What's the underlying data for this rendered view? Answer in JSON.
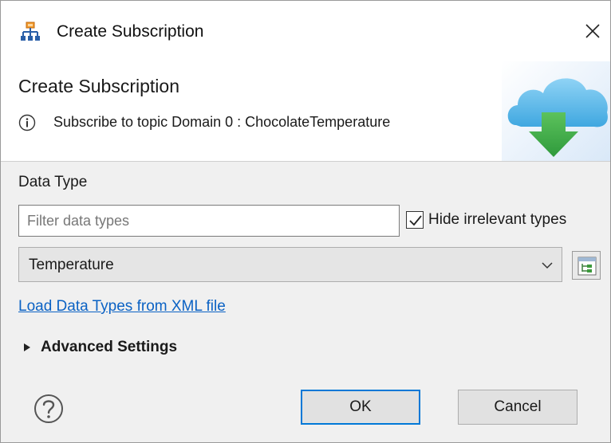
{
  "window": {
    "title": "Create Subscription",
    "app_icon": "network-tree-icon",
    "close_icon": "close-icon"
  },
  "header": {
    "title": "Create Subscription",
    "info_icon": "info-icon",
    "message": "Subscribe to topic Domain 0 : ChocolateTemperature",
    "banner_icon": "cloud-download-icon"
  },
  "data_type": {
    "label": "Data Type",
    "filter_placeholder": "Filter data types",
    "filter_value": "",
    "hide_irrelevant": {
      "label": "Hide irrelevant types",
      "checked": true
    },
    "selected_type": "Temperature",
    "dropdown_icon": "chevron-down-icon",
    "tree_button_icon": "type-tree-icon",
    "load_xml_link": "Load Data Types from XML file"
  },
  "advanced": {
    "label": "Advanced Settings",
    "expanded": false
  },
  "buttons": {
    "ok": "OK",
    "cancel": "Cancel",
    "help_icon": "help-icon"
  },
  "colors": {
    "link": "#0b62c4",
    "default_button_border": "#0078d7",
    "arrow_green": "#3aa845",
    "cloud_blue": "#5bb8ea"
  }
}
